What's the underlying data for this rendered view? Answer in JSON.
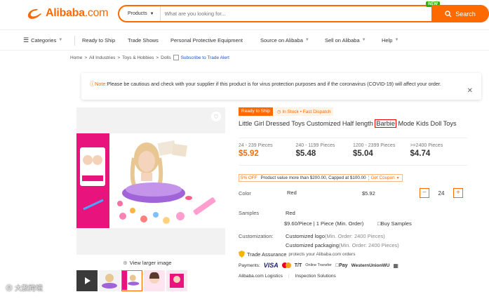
{
  "header": {
    "logo_text": "Alibaba",
    "logo_suffix": ".com",
    "search_category": "Products",
    "search_placeholder": "What are you looking for...",
    "search_button": "Search",
    "new_badge": "NEW"
  },
  "nav": {
    "categories": "Categories",
    "items": [
      "Ready to Ship",
      "Trade Shows",
      "Personal Protective Equipment",
      "Source on Alibaba",
      "Sell on Alibaba",
      "Help"
    ]
  },
  "breadcrumb": {
    "items": [
      "Home",
      "All Industries",
      "Toys & Hobbies",
      "Dolls"
    ],
    "subscribe": "Subscribe to Trade Alert"
  },
  "notice": {
    "label": "Note:",
    "text": "Please be cautious and check with your supplier if this product is for virus protection purposes and if the coronavirus (COVID-19) will affect your order."
  },
  "gallery": {
    "view_larger": "View larger image"
  },
  "product": {
    "tag_ready": "Ready to Ship",
    "tag_stock": "In Stock",
    "tag_dispatch": "Fast Dispatch",
    "title_before": "Little Girl Dressed Toys Customized Half length ",
    "title_highlight": "Barbie",
    "title_after": " Mode Kids Doll Toys",
    "tiers": [
      {
        "qty": "24 - 239 Pieces",
        "price": "$5.92"
      },
      {
        "qty": "240 - 1199 Pieces",
        "price": "$5.48"
      },
      {
        "qty": "1200 - 2399 Pieces",
        "price": "$5.04"
      },
      {
        "qty": ">=2400 Pieces",
        "price": "$4.74"
      }
    ],
    "promo": {
      "off": "5% OFF",
      "desc": "Product value more than $200.00, Capped at $100.00",
      "coupon": "Get Coupon"
    },
    "color_label": "Color",
    "color_value": "Red",
    "color_price": "$5.92",
    "quantity": "24",
    "samples_label": "Samples",
    "samples_value": "Red",
    "samples_price": "$9.60/Piece | 1 Piece (Min. Order)",
    "buy_samples": "Buy Samples",
    "customization_label": "Customization:",
    "custom_logo": "Customized logo",
    "custom_logo_note": "(Min. Order: 2400 Pieces)",
    "custom_pack": "Customized packaging",
    "custom_pack_note": "(Min. Order: 2400 Pieces)",
    "assurance_title": "Trade Assurance",
    "assurance_text": "protects your Alibaba.com orders",
    "payments_label": "Payments:",
    "payments": [
      "VISA",
      "T/T",
      "Online Transfer",
      "Pay",
      "WesternUnionWU"
    ],
    "logistics": "Alibaba.com Logistics",
    "inspection": "Inspection Solutions"
  },
  "watermark": "大數跨境",
  "colors": {
    "brand": "#ff6a00",
    "link": "#1a55c8",
    "highlight_box": "#e00000"
  }
}
